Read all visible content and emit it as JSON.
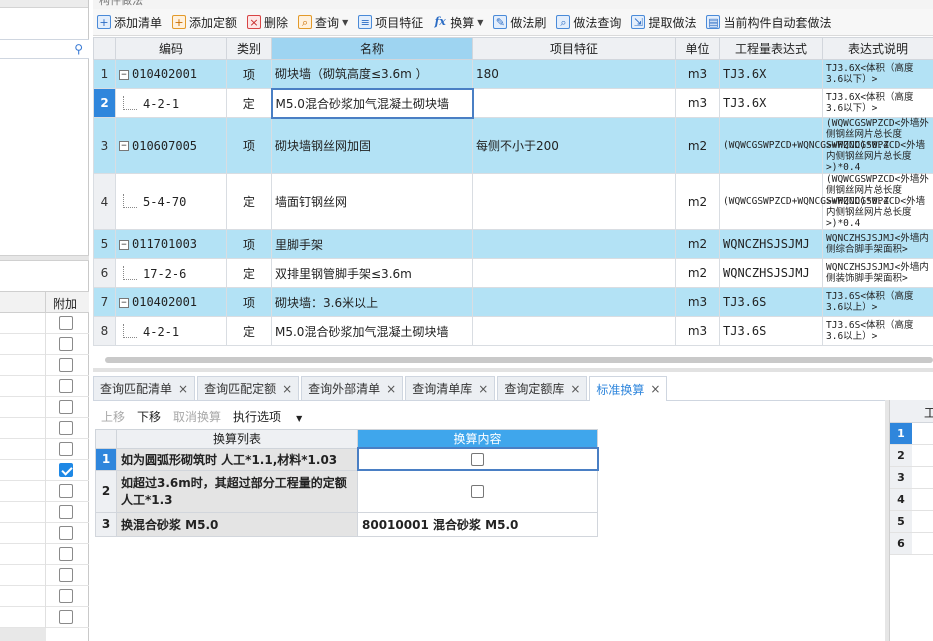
{
  "panel_title": "构件做法",
  "toolbar": [
    {
      "label": "添加清单",
      "icon": "add-list-icon"
    },
    {
      "label": "添加定额",
      "icon": "add-quota-icon"
    },
    {
      "label": "删除",
      "icon": "delete-icon"
    },
    {
      "label": "查询",
      "icon": "query-icon",
      "dropdown": true
    },
    {
      "label": "项目特征",
      "icon": "feature-icon"
    },
    {
      "label": "换算",
      "icon": "formula-icon",
      "dropdown": true
    },
    {
      "label": "做法刷",
      "icon": "brush-icon"
    },
    {
      "label": "做法查询",
      "icon": "method-query-icon"
    },
    {
      "label": "提取做法",
      "icon": "extract-icon"
    },
    {
      "label": "当前构件自动套做法",
      "icon": "auto-apply-icon"
    }
  ],
  "grid": {
    "headers": [
      "编码",
      "类别",
      "名称",
      "项目特征",
      "单位",
      "工程量表达式",
      "表达式说明"
    ],
    "rows": [
      {
        "n": "1",
        "code": "010402001",
        "type": "项",
        "name": "砌块墙（砌筑高度≤3.6m ）",
        "feature": "180",
        "unit": "m3",
        "expr": "TJ3.6X",
        "desc": "TJ3.6X<体积（高度3.6以下）>"
      },
      {
        "n": "2",
        "code": "4-2-1",
        "type": "定",
        "name": "M5.0混合砂浆加气混凝土砌块墙",
        "feature": "",
        "unit": "m3",
        "expr": "TJ3.6X",
        "desc": "TJ3.6X<体积（高度3.6以下）>"
      },
      {
        "n": "3",
        "code": "010607005",
        "type": "项",
        "name": "砌块墙钢丝网加固",
        "feature": "每侧不小于200",
        "unit": "m2",
        "expr": "(WQWCGSWPZCD+WQNCGSWPZCD)*0.4",
        "desc": "(WQWCGSWPZCD<外墙外侧钢丝网片总长度>+WQNCGSWPZCD<外墙内侧钢丝网片总长度>)*0.4"
      },
      {
        "n": "4",
        "code": "5-4-70",
        "type": "定",
        "name": "墙面钉钢丝网",
        "feature": "",
        "unit": "m2",
        "expr": "(WQWCGSWPZCD+WQNCGSWPZCD)*0.4",
        "desc": "(WQWCGSWPZCD<外墙外侧钢丝网片总长度>+WQNCGSWPZCD<外墙内侧钢丝网片总长度>)*0.4"
      },
      {
        "n": "5",
        "code": "011701003",
        "type": "项",
        "name": "里脚手架",
        "feature": "",
        "unit": "m2",
        "expr": "WQNCZHSJSJMJ",
        "desc": "WQNCZHSJSJMJ<外墙内侧综合脚手架面积>"
      },
      {
        "n": "6",
        "code": "17-2-6",
        "type": "定",
        "name": "双排里钢管脚手架≤3.6m",
        "feature": "",
        "unit": "m2",
        "expr": "WQNCZHSJSJMJ",
        "desc": "WQNCZHSJSJMJ<外墙内侧装饰脚手架面积>"
      },
      {
        "n": "7",
        "code": "010402001",
        "type": "项",
        "name": "砌块墙：3.6米以上",
        "feature": "",
        "unit": "m3",
        "expr": "TJ3.6S",
        "desc": "TJ3.6S<体积（高度3.6以上）>"
      },
      {
        "n": "8",
        "code": "4-2-1",
        "type": "定",
        "name": "M5.0混合砂浆加气混凝土砌块墙",
        "feature": "",
        "unit": "m3",
        "expr": "TJ3.6S",
        "desc": "TJ3.6S<体积（高度3.6以上）>"
      }
    ]
  },
  "tabs": [
    {
      "label": "查询匹配清单"
    },
    {
      "label": "查询匹配定额"
    },
    {
      "label": "查询外部清单"
    },
    {
      "label": "查询清单库"
    },
    {
      "label": "查询定额库"
    },
    {
      "label": "标准换算"
    }
  ],
  "subbar": {
    "up": "上移",
    "down": "下移",
    "cancel": "取消换算",
    "exec": "执行选项"
  },
  "conv": {
    "headers": [
      "换算列表",
      "换算内容"
    ],
    "rows": [
      {
        "n": "1",
        "name": "如为圆弧形砌筑时 人工*1.1,材料*1.03",
        "content": ""
      },
      {
        "n": "2",
        "name": "如超过3.6m时，其超过部分工程量的定额人工*1.3",
        "content": ""
      },
      {
        "n": "3",
        "name": "换混合砂浆 M5.0",
        "content": "80010001  混合砂浆 M5.0"
      }
    ]
  },
  "left": {
    "header": "附加",
    "checks": [
      false,
      false,
      false,
      false,
      false,
      false,
      false,
      true,
      false,
      false,
      false,
      false,
      false,
      false,
      false
    ]
  },
  "right": {
    "header": "工",
    "rows": [
      "1",
      "2",
      "3",
      "4",
      "5",
      "6"
    ]
  },
  "colors": {
    "highlight": "#b3e2f5",
    "accent": "#2f86dc",
    "header_selected": "#9ed4f1"
  }
}
